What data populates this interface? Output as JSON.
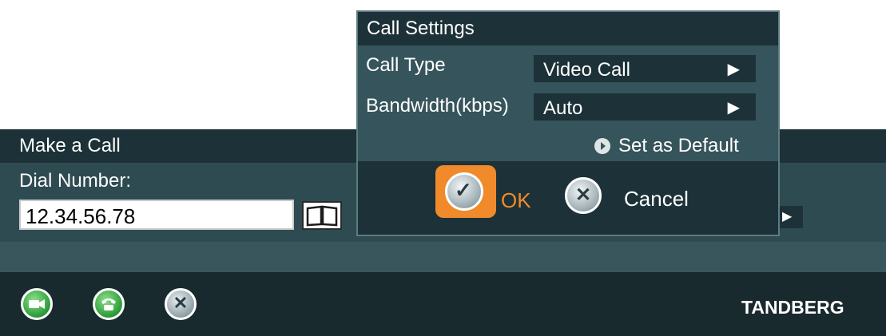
{
  "make_call": {
    "title": "Make a Call",
    "dial_label": "Dial Number:",
    "dial_value": "12.34.56.78"
  },
  "brand": "TANDBERG",
  "call_settings": {
    "title": "Call Settings",
    "call_type_label": "Call Type",
    "call_type_value": "Video Call",
    "bandwidth_label": "Bandwidth(kbps)",
    "bandwidth_value": "Auto",
    "set_default_label": "Set as Default",
    "ok_label": "OK",
    "cancel_label": "Cancel"
  },
  "icons": {
    "select_arrow": "▶",
    "ok_check": "✓",
    "cancel_x": "✕"
  },
  "colors": {
    "accent": "#f08a2a",
    "panel": "#2f4b52",
    "header": "#1c3238"
  }
}
